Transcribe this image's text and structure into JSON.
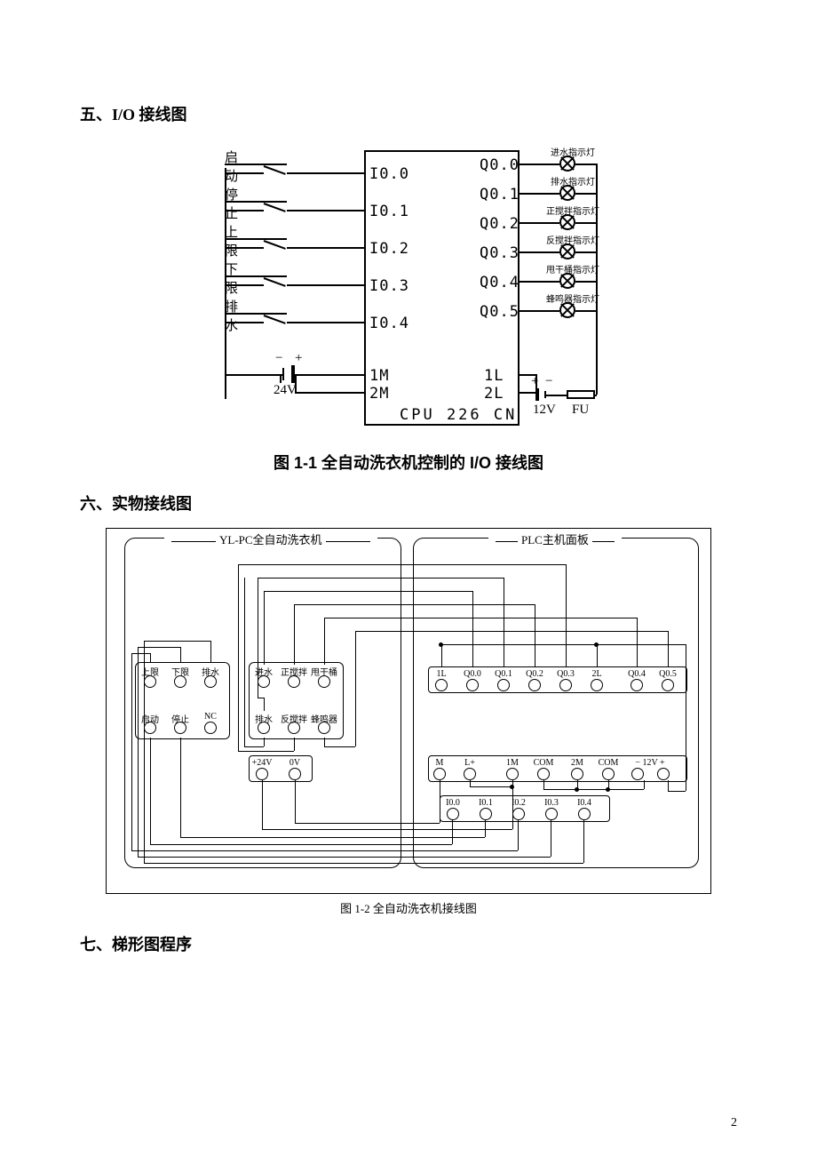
{
  "headings": {
    "h5": "五、I/O 接线图",
    "h6": "六、实物接线图",
    "h7": "七、梯形图程序"
  },
  "captions": {
    "fig1": "图 1-1 全自动洗衣机控制的 I/O 接线图",
    "fig2": "图 1-2 全自动洗衣机接线图"
  },
  "page_number": "2",
  "fig1": {
    "inputs": [
      {
        "name": "启动",
        "io": "I0.0"
      },
      {
        "name": "停止",
        "io": "I0.1"
      },
      {
        "name": "上限",
        "io": "I0.2"
      },
      {
        "name": "下限",
        "io": "I0.3"
      },
      {
        "name": "排水",
        "io": "I0.4"
      }
    ],
    "outputs": [
      {
        "io": "Q0.0",
        "label": "进水指示灯"
      },
      {
        "io": "Q0.1",
        "label": "排水指示灯"
      },
      {
        "io": "Q0.2",
        "label": "正搅拌指示灯"
      },
      {
        "io": "Q0.3",
        "label": "反搅拌指示灯"
      },
      {
        "io": "Q0.4",
        "label": "甩干桶指示灯"
      },
      {
        "io": "Q0.5",
        "label": "蜂鸣器指示灯"
      }
    ],
    "m_labels": {
      "m1": "1M",
      "m2": "2M",
      "l1": "1L",
      "l2": "2L"
    },
    "cpu": "CPU  226  CN",
    "supply_in": {
      "v": "24V",
      "neg": "−",
      "pos": "+"
    },
    "supply_out": {
      "v": "12V",
      "neg": "−",
      "pos": "+",
      "fu": "FU"
    }
  },
  "fig2": {
    "title_left": "YL-PC全自动洗衣机",
    "title_right": "PLC主机面板",
    "left_mod_top": [
      "上限",
      "下限",
      "排水"
    ],
    "left_mod_bot": [
      "启动",
      "停止",
      "NC"
    ],
    "mid_mod_top": [
      "进水",
      "正搅拌",
      "甩干桶"
    ],
    "mid_mod_bot": [
      "排水",
      "反搅拌",
      "蜂鸣器"
    ],
    "supply_row": [
      "+24V",
      "0V"
    ],
    "right_top": [
      "1L",
      "Q0.0",
      "Q0.1",
      "Q0.2",
      "Q0.3",
      "2L",
      "Q0.4",
      "Q0.5"
    ],
    "right_mid": [
      "M",
      "L+",
      "1M",
      "COM",
      "2M",
      "COM",
      "− 12V +"
    ],
    "right_bot": [
      "I0.0",
      "I0.1",
      "I0.2",
      "I0.3",
      "I0.4"
    ]
  }
}
